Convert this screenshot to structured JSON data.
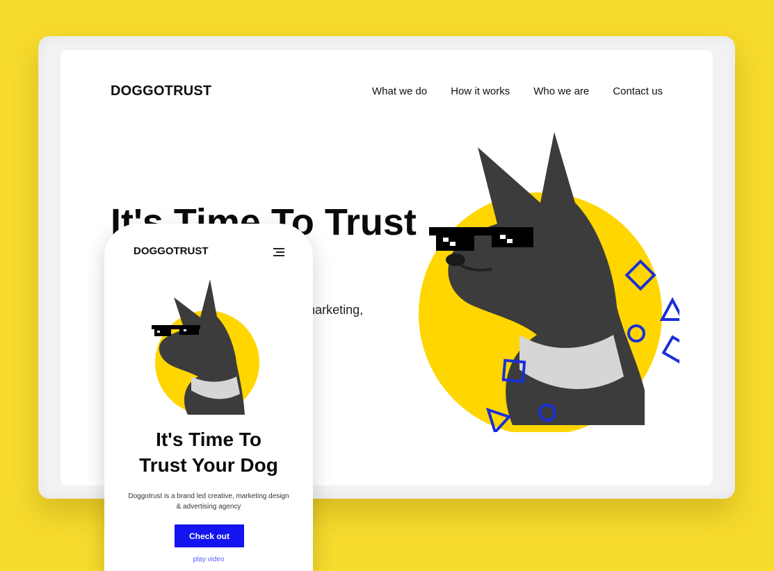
{
  "brand": {
    "logo": "DOGGOTRUST"
  },
  "desktop": {
    "nav": [
      "What we do",
      "How it works",
      "Who we are",
      "Contact us"
    ],
    "hero_title": "It's Time To Trust Your Dog",
    "hero_sub": "Doggotrust is a brand led creative, marketing, design & advertising agency"
  },
  "mobile": {
    "logo": "DOGGOTRUST",
    "hero_title_line1": "It's Time To",
    "hero_title_line2": "Trust Your Dog",
    "hero_sub": "Doggotrust is a brand led creative, marketing design & advertising agency",
    "cta_label": "Check out",
    "secondary_link": "play video"
  },
  "colors": {
    "background": "#F6DA2C",
    "accent_yellow": "#FFD600",
    "accent_blue": "#1414F0",
    "shape_blue": "#1A2FD6"
  },
  "icons": {
    "menu": "hamburger-menu-icon"
  }
}
